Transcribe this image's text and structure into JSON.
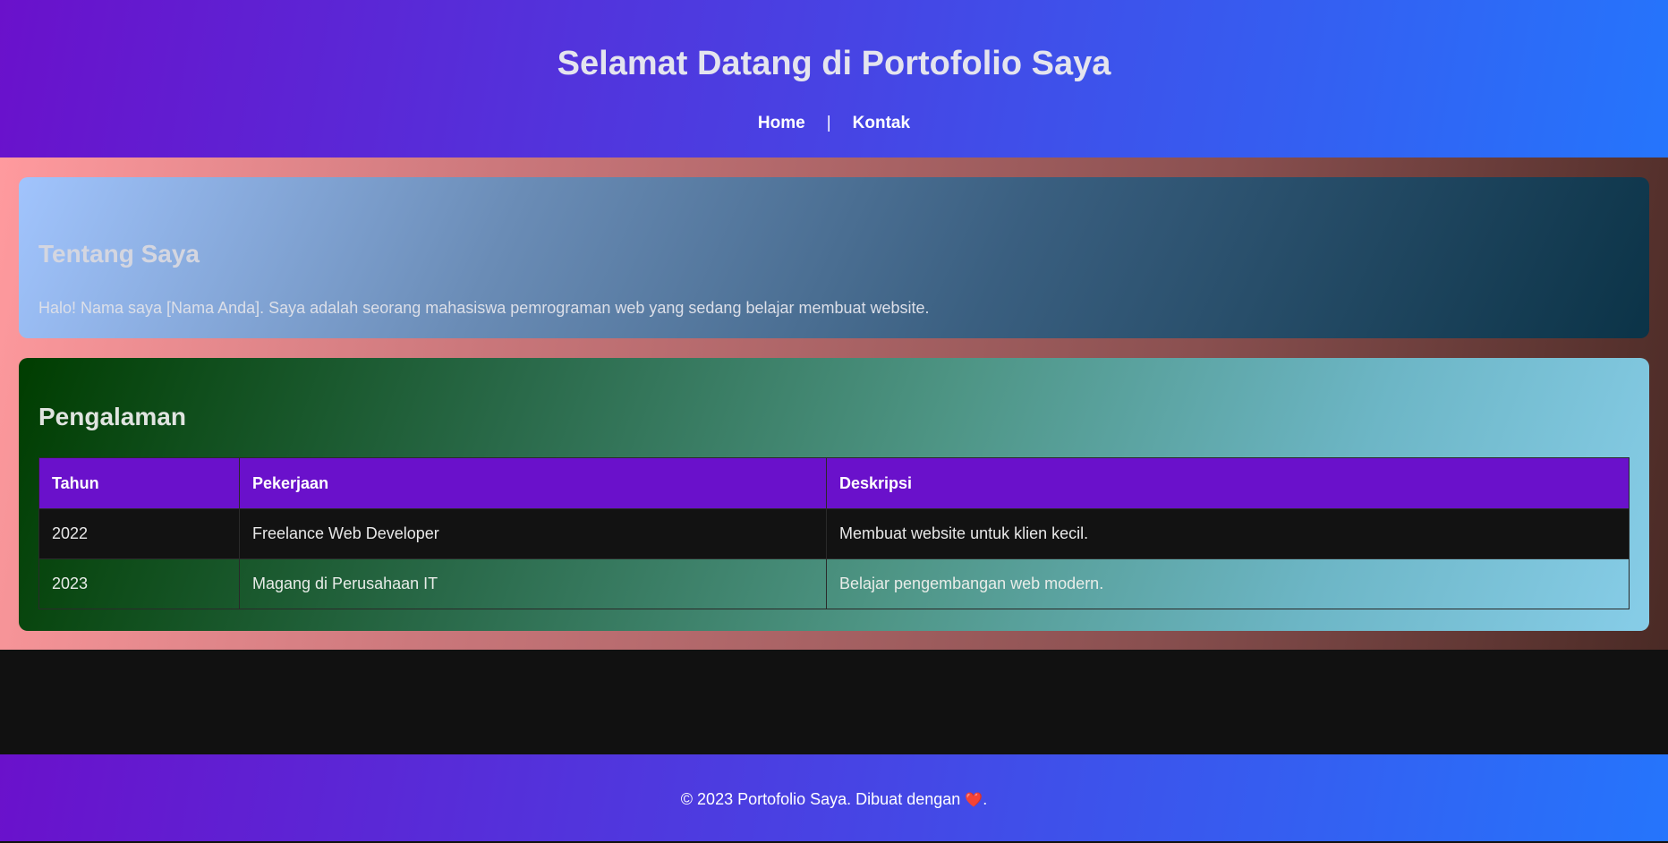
{
  "header": {
    "title": "Selamat Datang di Portofolio Saya",
    "nav": [
      {
        "label": "Home"
      },
      {
        "label": "Kontak"
      }
    ],
    "nav_separator": "|"
  },
  "about": {
    "heading": "Tentang Saya",
    "text": "Halo! Nama saya [Nama Anda]. Saya adalah seorang mahasiswa pemrograman web yang sedang belajar membuat website."
  },
  "experience": {
    "heading": "Pengalaman",
    "columns": [
      "Tahun",
      "Pekerjaan",
      "Deskripsi"
    ],
    "rows": [
      {
        "year": "2022",
        "job": "Freelance Web Developer",
        "desc": "Membuat website untuk klien kecil."
      },
      {
        "year": "2023",
        "job": "Magang di Perusahaan IT",
        "desc": "Belajar pengembangan web modern."
      }
    ]
  },
  "footer": {
    "text": "© 2023 Portofolio Saya. Dibuat dengan",
    "heart": "❤️",
    "end": "."
  },
  "colors": {
    "header_gradient_start": "#6a11cb",
    "header_gradient_end": "#2575fc",
    "table_header_bg": "#6a11cb"
  }
}
